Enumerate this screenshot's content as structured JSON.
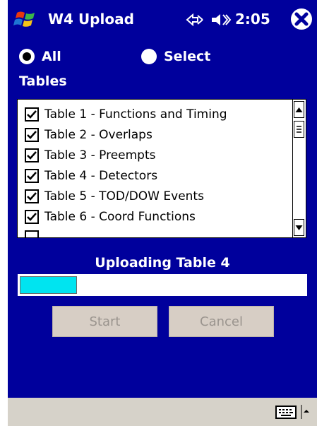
{
  "window": {
    "title": "W4 Upload",
    "clock": "2:05"
  },
  "icons": {
    "start": "windows-flag-icon",
    "sync": "sync-icon",
    "volume": "volume-icon",
    "close": "close-icon",
    "keyboard": "keyboard-icon",
    "sip_arrow": "arrow-up-icon"
  },
  "selection": {
    "all_label": "All",
    "select_label": "Select",
    "selected": "All"
  },
  "tables": {
    "label": "Tables",
    "items": [
      {
        "label": "Table 1 - Functions and Timing",
        "checked": true
      },
      {
        "label": "Table 2 - Overlaps",
        "checked": true
      },
      {
        "label": "Table 3 - Preempts",
        "checked": true
      },
      {
        "label": "Table 4 - Detectors",
        "checked": true
      },
      {
        "label": "Table 5 - TOD/DOW Events",
        "checked": true
      },
      {
        "label": "Table 6 - Coord Functions",
        "checked": true
      }
    ]
  },
  "status": {
    "text": "Uploading Table 4",
    "progress": 0.2
  },
  "buttons": {
    "start": "Start",
    "cancel": "Cancel",
    "enabled": false
  },
  "colors": {
    "background": "#00009c",
    "progress_fill": "#00e4f0",
    "menubar": "#d6d2c9",
    "button_face": "#d7cec5",
    "button_text_disabled": "#9a948e"
  }
}
